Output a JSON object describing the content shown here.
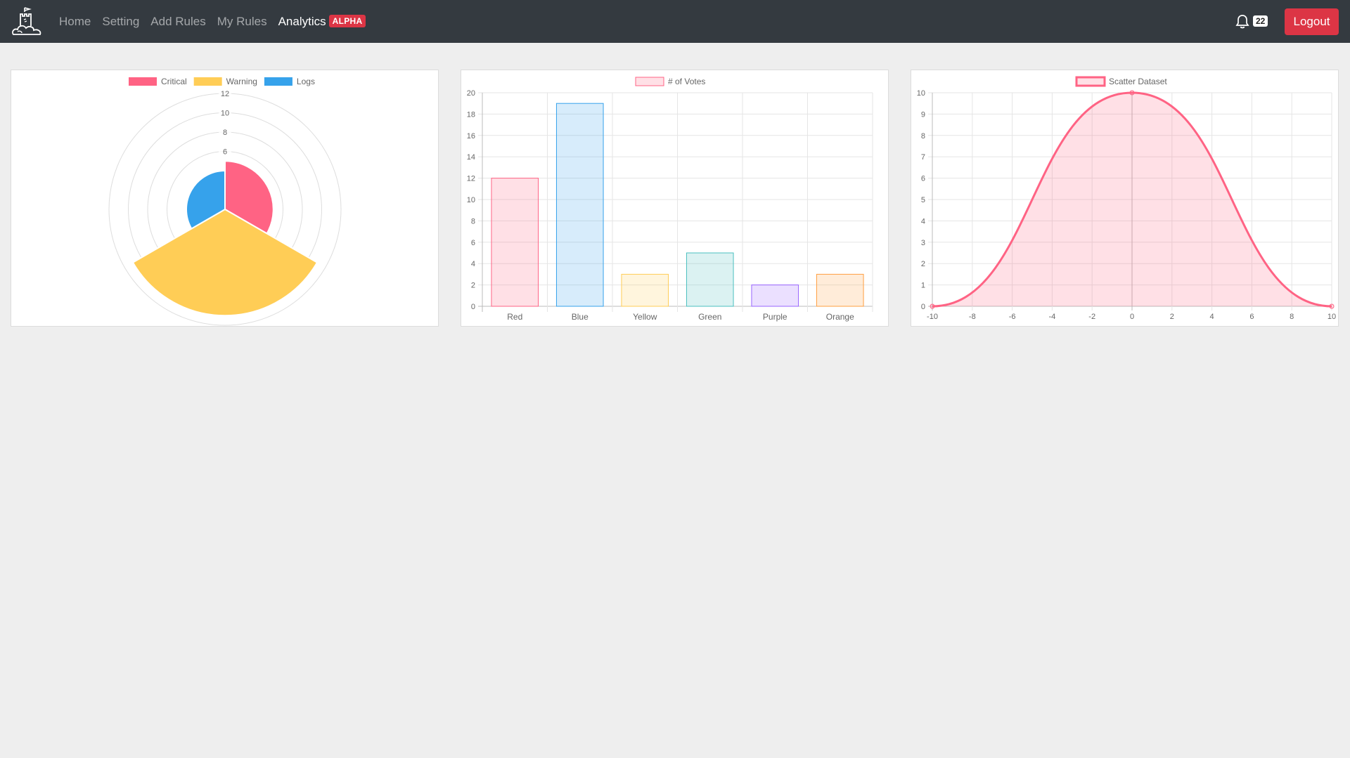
{
  "nav": {
    "links": [
      "Home",
      "Setting",
      "Add Rules",
      "My Rules"
    ],
    "active": "Analytics",
    "badge": "ALPHA",
    "notification_count": "22",
    "logout": "Logout"
  },
  "icons": {
    "logo": "castle-cloud-logo-icon",
    "bell": "bell-icon"
  },
  "colors": {
    "navbar": "#343a40",
    "danger": "#dc3545",
    "red": "#ff6384",
    "yellow": "#ffcd56",
    "blue": "#36a2eb",
    "teal": "#4bc0c0",
    "purple": "#9966ff",
    "orange": "#ff9f40"
  },
  "chart_data": [
    {
      "type": "polarArea",
      "labels": [
        "Critical",
        "Warning",
        "Logs"
      ],
      "values": [
        5,
        11,
        4
      ],
      "colors": [
        "#ff6384",
        "#ffcd56",
        "#36a2eb"
      ],
      "r_ticks": [
        "6",
        "8",
        "10",
        "12"
      ],
      "rlim": [
        0,
        12
      ],
      "legend": "top"
    },
    {
      "type": "bar",
      "series": [
        {
          "name": "# of Votes",
          "values": [
            12,
            19,
            3,
            5,
            2,
            3
          ]
        }
      ],
      "categories": [
        "Red",
        "Blue",
        "Yellow",
        "Green",
        "Purple",
        "Orange"
      ],
      "colors": [
        "#ff6384",
        "#36a2eb",
        "#ffcd56",
        "#4bc0c0",
        "#9966ff",
        "#ff9f40"
      ],
      "ylim": [
        0,
        20
      ],
      "y_ticks": [
        "0",
        "2",
        "4",
        "6",
        "8",
        "10",
        "12",
        "14",
        "16",
        "18",
        "20"
      ],
      "legend": "top"
    },
    {
      "type": "area",
      "series": [
        {
          "name": "Scatter Dataset",
          "x": [
            -10,
            0,
            10
          ],
          "y": [
            0,
            10,
            0
          ]
        }
      ],
      "xlim": [
        -10,
        10
      ],
      "ylim": [
        0,
        10
      ],
      "x_ticks": [
        "-10",
        "-8",
        "-6",
        "-4",
        "-2",
        "0",
        "2",
        "4",
        "6",
        "8",
        "10"
      ],
      "y_ticks": [
        "0",
        "1",
        "2",
        "3",
        "4",
        "5",
        "6",
        "7",
        "8",
        "9",
        "10"
      ],
      "color": "#ff6384",
      "legend": "top"
    }
  ]
}
